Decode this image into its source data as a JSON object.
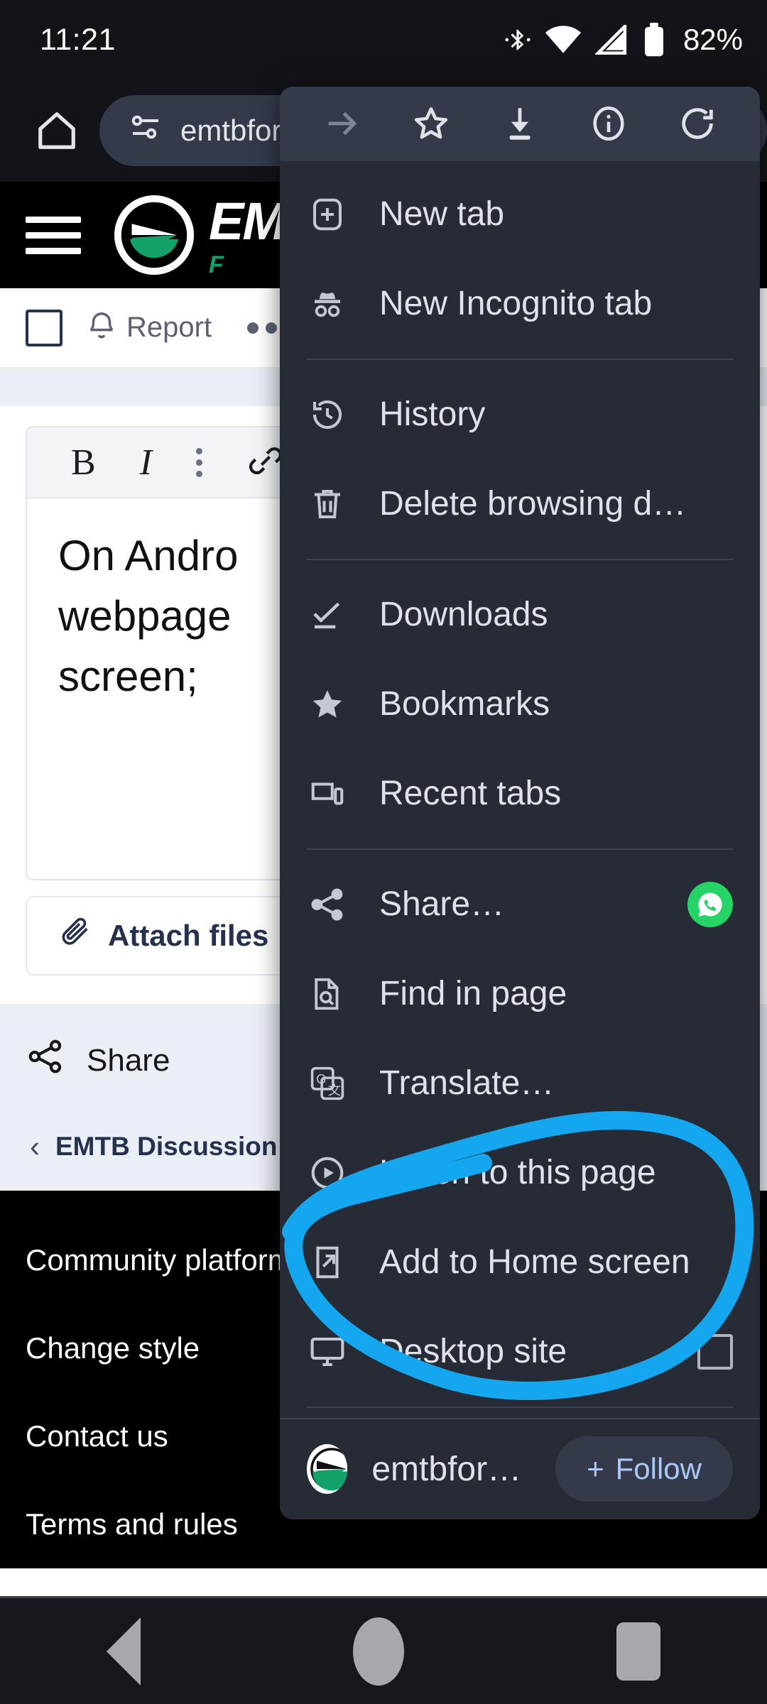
{
  "status_bar": {
    "clock": "11:21",
    "battery_percent": "82%",
    "icons": [
      "bluetooth-icon",
      "wifi-icon",
      "cellular-signal-icon",
      "battery-icon"
    ]
  },
  "browser_toolbar": {
    "home_icon": "home-icon",
    "omnibox": {
      "tune_icon": "page-settings-icon",
      "url_text": "emtbfor"
    }
  },
  "webpage": {
    "site_header": {
      "menu_icon": "hamburger-menu-icon",
      "logo_text": "EM",
      "logo_sub": "F"
    },
    "report_bar": {
      "checkbox": "selection-checkbox",
      "report_label": "Report",
      "bell_icon": "bell-icon",
      "more_icon": "more-options-icon"
    },
    "editor": {
      "toolbar": [
        "bold-icon",
        "italic-icon",
        "more-format-icon",
        "link-icon"
      ],
      "bold_label": "B",
      "italic_label": "I",
      "body_lines": [
        "On Andro",
        "webpage",
        "screen;"
      ]
    },
    "attach_button": "Attach files",
    "share_label": "Share",
    "breadcrumb": "EMTB Discussion",
    "footer_links": [
      "Community platform",
      "Change style",
      "Contact us",
      "Terms and rules"
    ]
  },
  "chrome_menu": {
    "header_icons": [
      "forward-arrow-icon",
      "bookmark-star-icon",
      "download-icon",
      "page-info-icon",
      "reload-icon"
    ],
    "items": [
      {
        "icon": "new-tab-icon",
        "label": "New tab",
        "trailing": ""
      },
      {
        "icon": "incognito-icon",
        "label": "New Incognito tab",
        "trailing": ""
      },
      {
        "icon": "history-icon",
        "label": "History",
        "trailing": ""
      },
      {
        "icon": "trash-icon",
        "label": "Delete browsing d…",
        "trailing": ""
      },
      {
        "icon": "downloads-icon",
        "label": "Downloads",
        "trailing": ""
      },
      {
        "icon": "bookmarks-star-icon",
        "label": "Bookmarks",
        "trailing": ""
      },
      {
        "icon": "recent-tabs-icon",
        "label": "Recent tabs",
        "trailing": ""
      },
      {
        "icon": "share-icon",
        "label": "Share…",
        "trailing": "whatsapp-icon"
      },
      {
        "icon": "find-in-page-icon",
        "label": "Find in page",
        "trailing": ""
      },
      {
        "icon": "translate-icon",
        "label": "Translate…",
        "trailing": ""
      },
      {
        "icon": "listen-play-icon",
        "label": "Listen to this page",
        "trailing": ""
      },
      {
        "icon": "add-to-home-icon",
        "label": "Add to Home screen",
        "trailing": ""
      },
      {
        "icon": "desktop-site-icon",
        "label": "Desktop site",
        "trailing": "checkbox"
      }
    ],
    "footer": {
      "site_icon": "emtb-site-icon",
      "site_name": "emtbfor…",
      "follow_label": "Follow",
      "plus_label": "+"
    }
  },
  "annotation": {
    "shape": "hand-drawn-circle",
    "color": "#14A7F0",
    "encircles": [
      "Listen to this page",
      "Add to Home screen",
      "Desktop site"
    ]
  },
  "nav_bar": {
    "back": "back-button",
    "home": "home-button",
    "recents": "recents-button"
  }
}
